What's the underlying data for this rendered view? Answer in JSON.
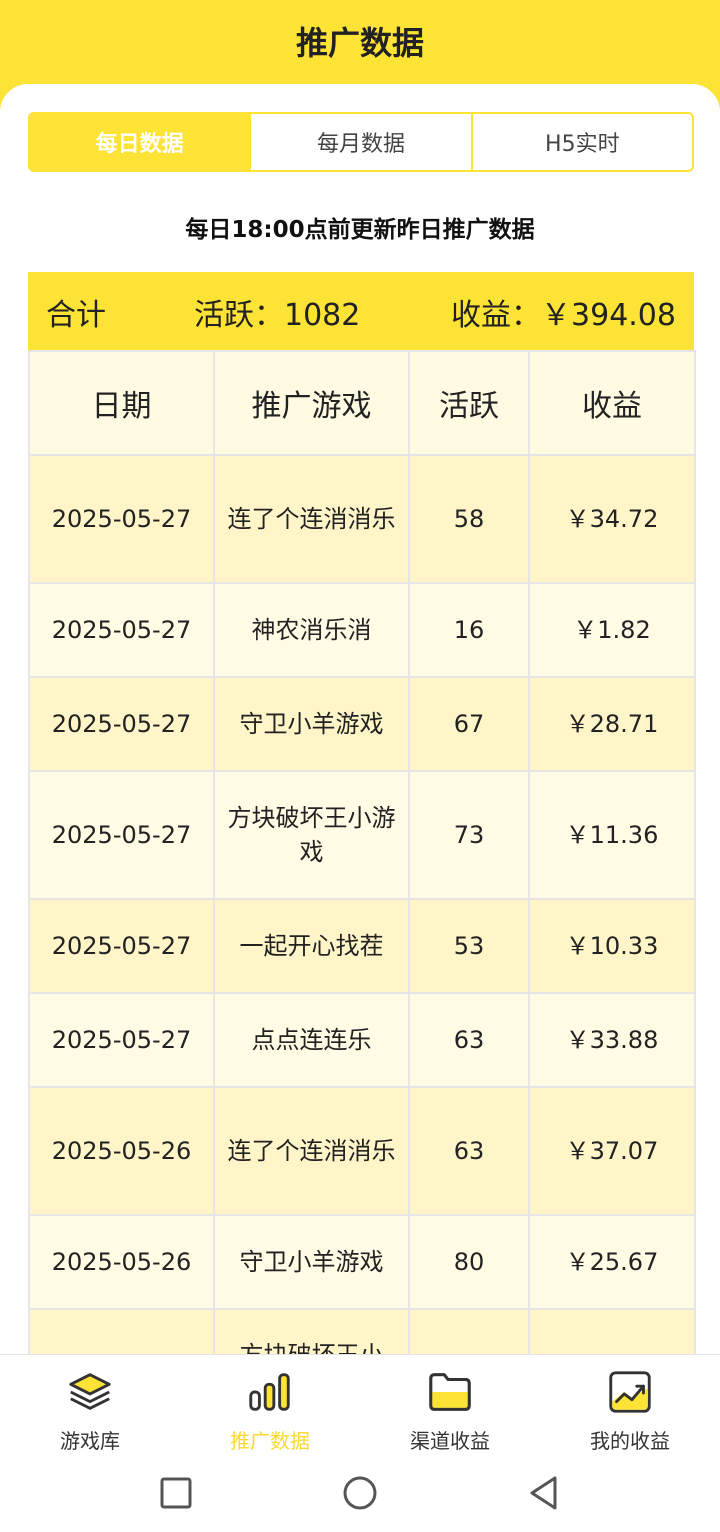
{
  "header": {
    "title": "推广数据"
  },
  "tabs": [
    {
      "label": "每日数据",
      "active": true
    },
    {
      "label": "每月数据",
      "active": false
    },
    {
      "label": "H5实时",
      "active": false
    }
  ],
  "notice": "每日18:00点前更新昨日推广数据",
  "total": {
    "label": "合计",
    "active_text": "活跃：1082",
    "income_text": "收益：￥394.08"
  },
  "table": {
    "headers": [
      "日期",
      "推广游戏",
      "活跃",
      "收益"
    ],
    "rows": [
      {
        "date": "2025-05-27",
        "game": "连了个连消消乐",
        "active": "58",
        "income": "￥34.72"
      },
      {
        "date": "2025-05-27",
        "game": "神农消乐消",
        "active": "16",
        "income": "￥1.82"
      },
      {
        "date": "2025-05-27",
        "game": "守卫小羊游戏",
        "active": "67",
        "income": "￥28.71"
      },
      {
        "date": "2025-05-27",
        "game": "方块破坏王小游戏",
        "active": "73",
        "income": "￥11.36"
      },
      {
        "date": "2025-05-27",
        "game": "一起开心找茬",
        "active": "53",
        "income": "￥10.33"
      },
      {
        "date": "2025-05-27",
        "game": "点点连连乐",
        "active": "63",
        "income": "￥33.88"
      },
      {
        "date": "2025-05-26",
        "game": "连了个连消消乐",
        "active": "63",
        "income": "￥37.07"
      },
      {
        "date": "2025-05-26",
        "game": "守卫小羊游戏",
        "active": "80",
        "income": "￥25.67"
      },
      {
        "date": "",
        "game": "方块破坏王小",
        "active": "",
        "income": ""
      }
    ]
  },
  "bottom_nav": [
    {
      "label": "游戏库",
      "icon": "layers-icon",
      "active": false
    },
    {
      "label": "推广数据",
      "icon": "bar-chart-icon",
      "active": true
    },
    {
      "label": "渠道收益",
      "icon": "folder-icon",
      "active": false
    },
    {
      "label": "我的收益",
      "icon": "trend-chart-icon",
      "active": false
    }
  ],
  "colors": {
    "accent": "#fde335",
    "row_odd": "#fff5c9",
    "row_even": "#fffbe5"
  }
}
